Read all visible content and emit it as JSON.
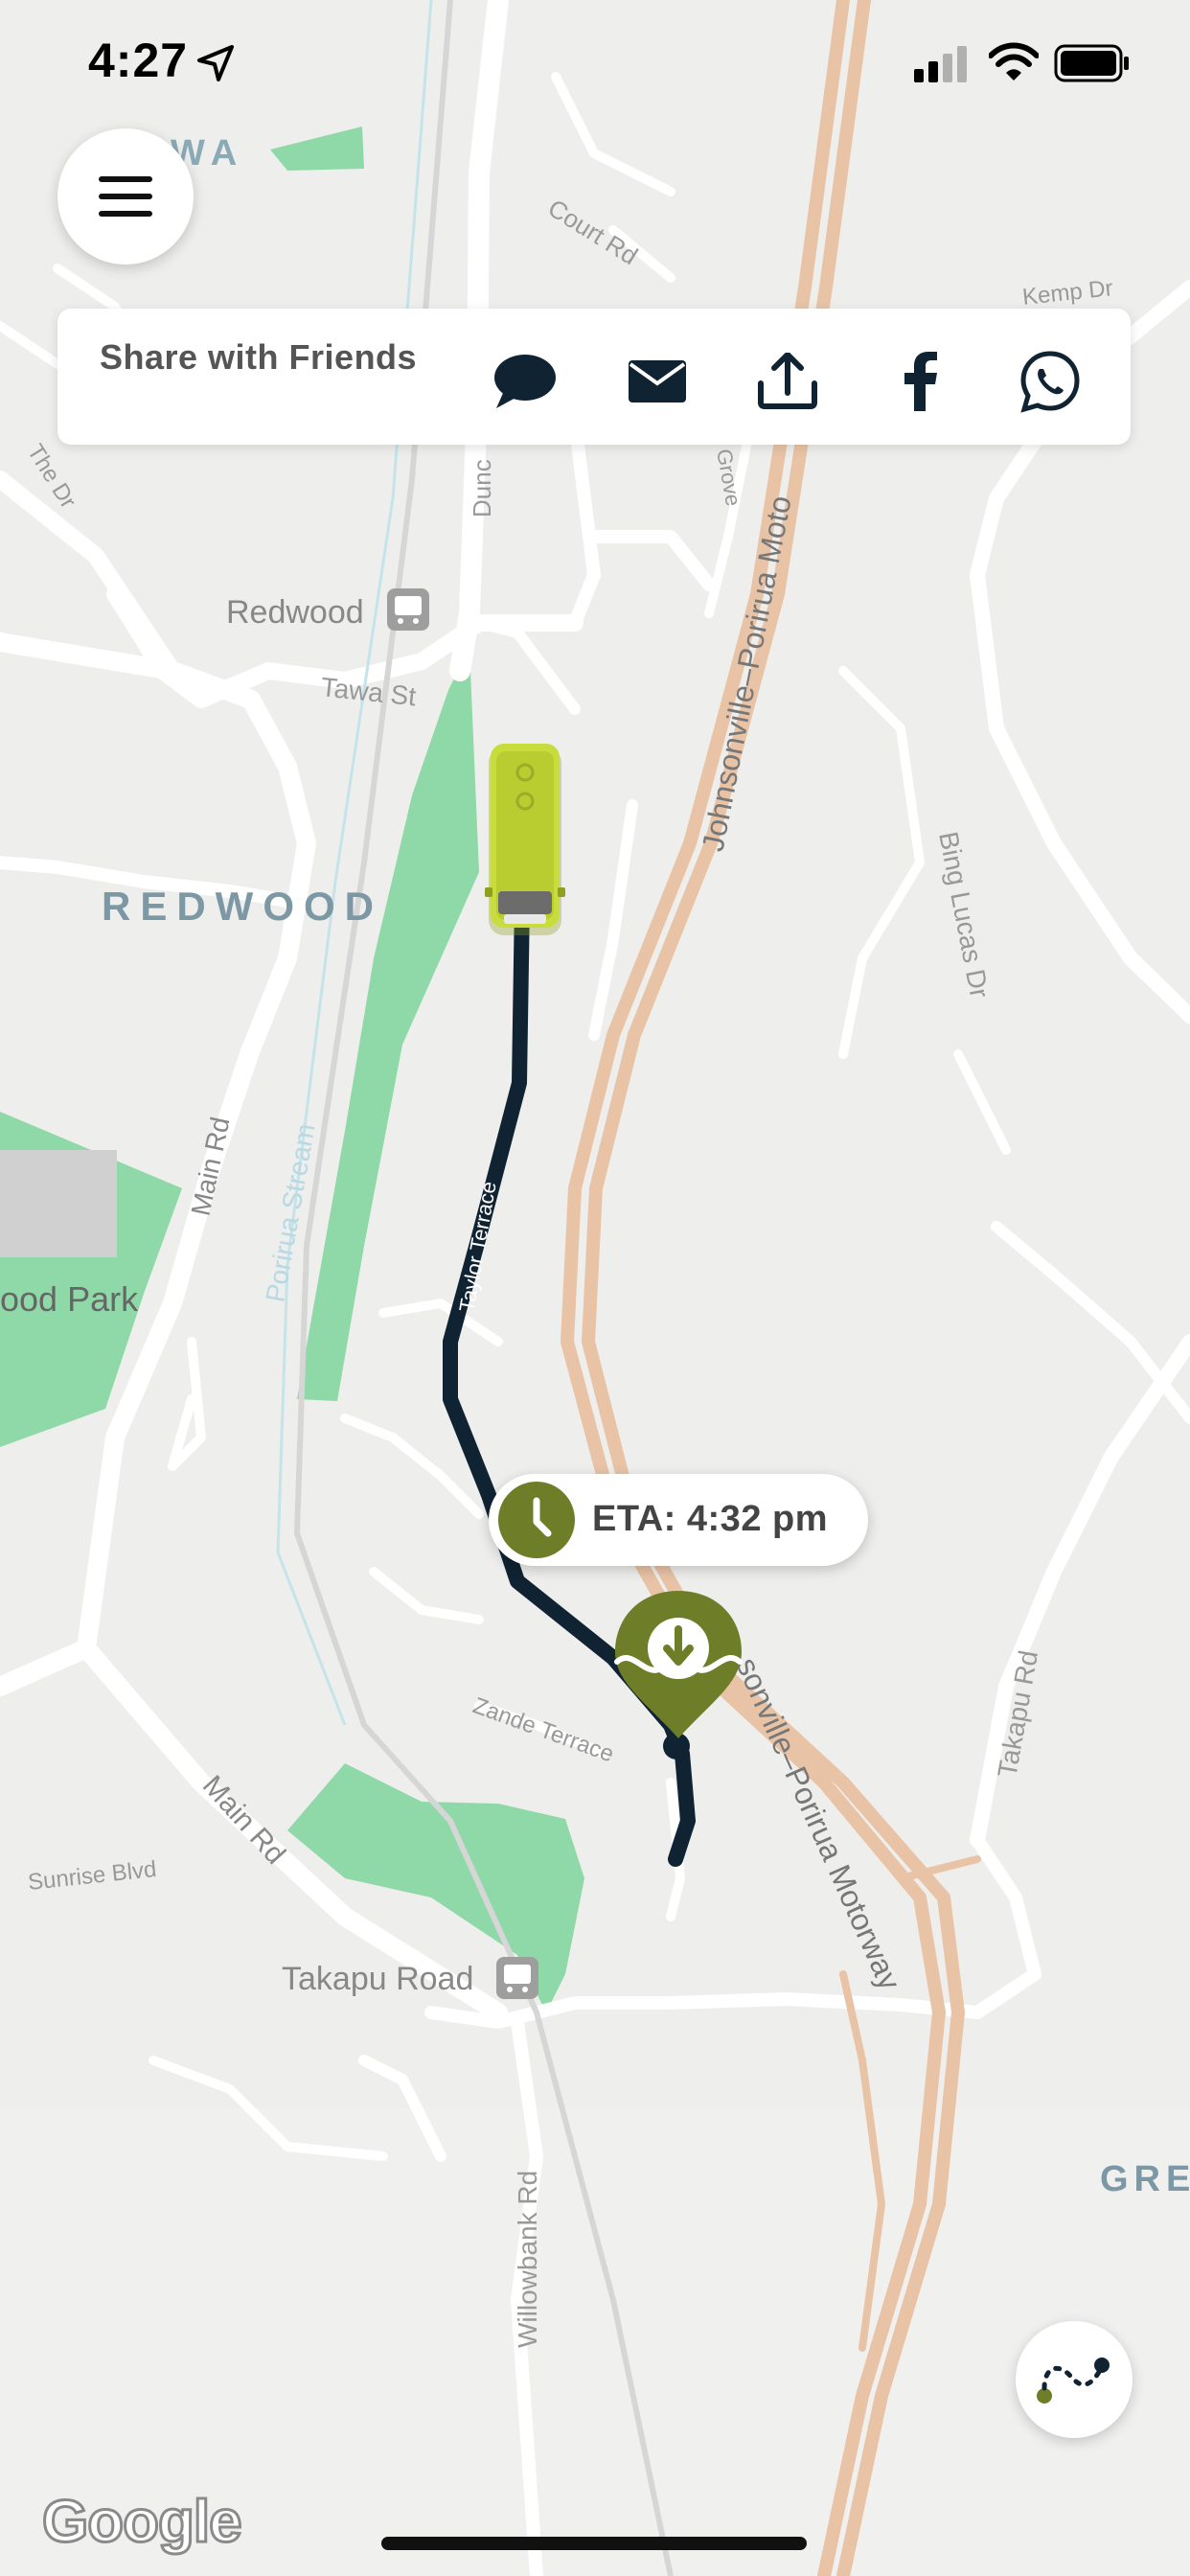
{
  "status_bar": {
    "time": "4:27"
  },
  "map": {
    "labels": {
      "wa": "WA",
      "court_rd": "Court Rd",
      "kemp_dr": "Kemp Dr",
      "the_dr": "The Dr",
      "dunc": "Dunc",
      "grove": "Grove",
      "redwood_station": "Redwood",
      "tawa_st": "Tawa St",
      "johnsonville_porirua_motorway_north": "Johnsonville–Porirua Moto",
      "redwood_suburb": "REDWOOD",
      "bing_lucas_dr": "Bing Lucas Dr",
      "main_rd_upper": "Main Rd",
      "porirua_stream": "Porirua Stream",
      "taylor_terrace": "Taylor Terrace",
      "wood_park": "ood Park",
      "takapu_rd_east": "Takapu Rd",
      "johnsonville_porirua_motorway_south": "sonville–Porirua Motorway",
      "zande_terrace": "Zande Terrace",
      "main_rd_lower": "Main Rd",
      "sunrise_blvd": "Sunrise Blvd",
      "takapu_road_station": "Takapu Road",
      "willowbank_rd": "Willowbank Rd",
      "gre": "GRE"
    }
  },
  "share": {
    "title": "Share with Friends",
    "icons": [
      "chat-icon",
      "mail-icon",
      "upload-share-icon",
      "facebook-icon",
      "whatsapp-icon"
    ]
  },
  "eta": {
    "label": "ETA: 4:32 pm"
  },
  "attribution": {
    "text": "Google"
  },
  "colors": {
    "accent_green": "#6e7d28",
    "route": "#0f2332",
    "park_green": "#8fd9a8",
    "motorway": "#e9c3a6",
    "bus_yellow": "#c8dc3c"
  }
}
